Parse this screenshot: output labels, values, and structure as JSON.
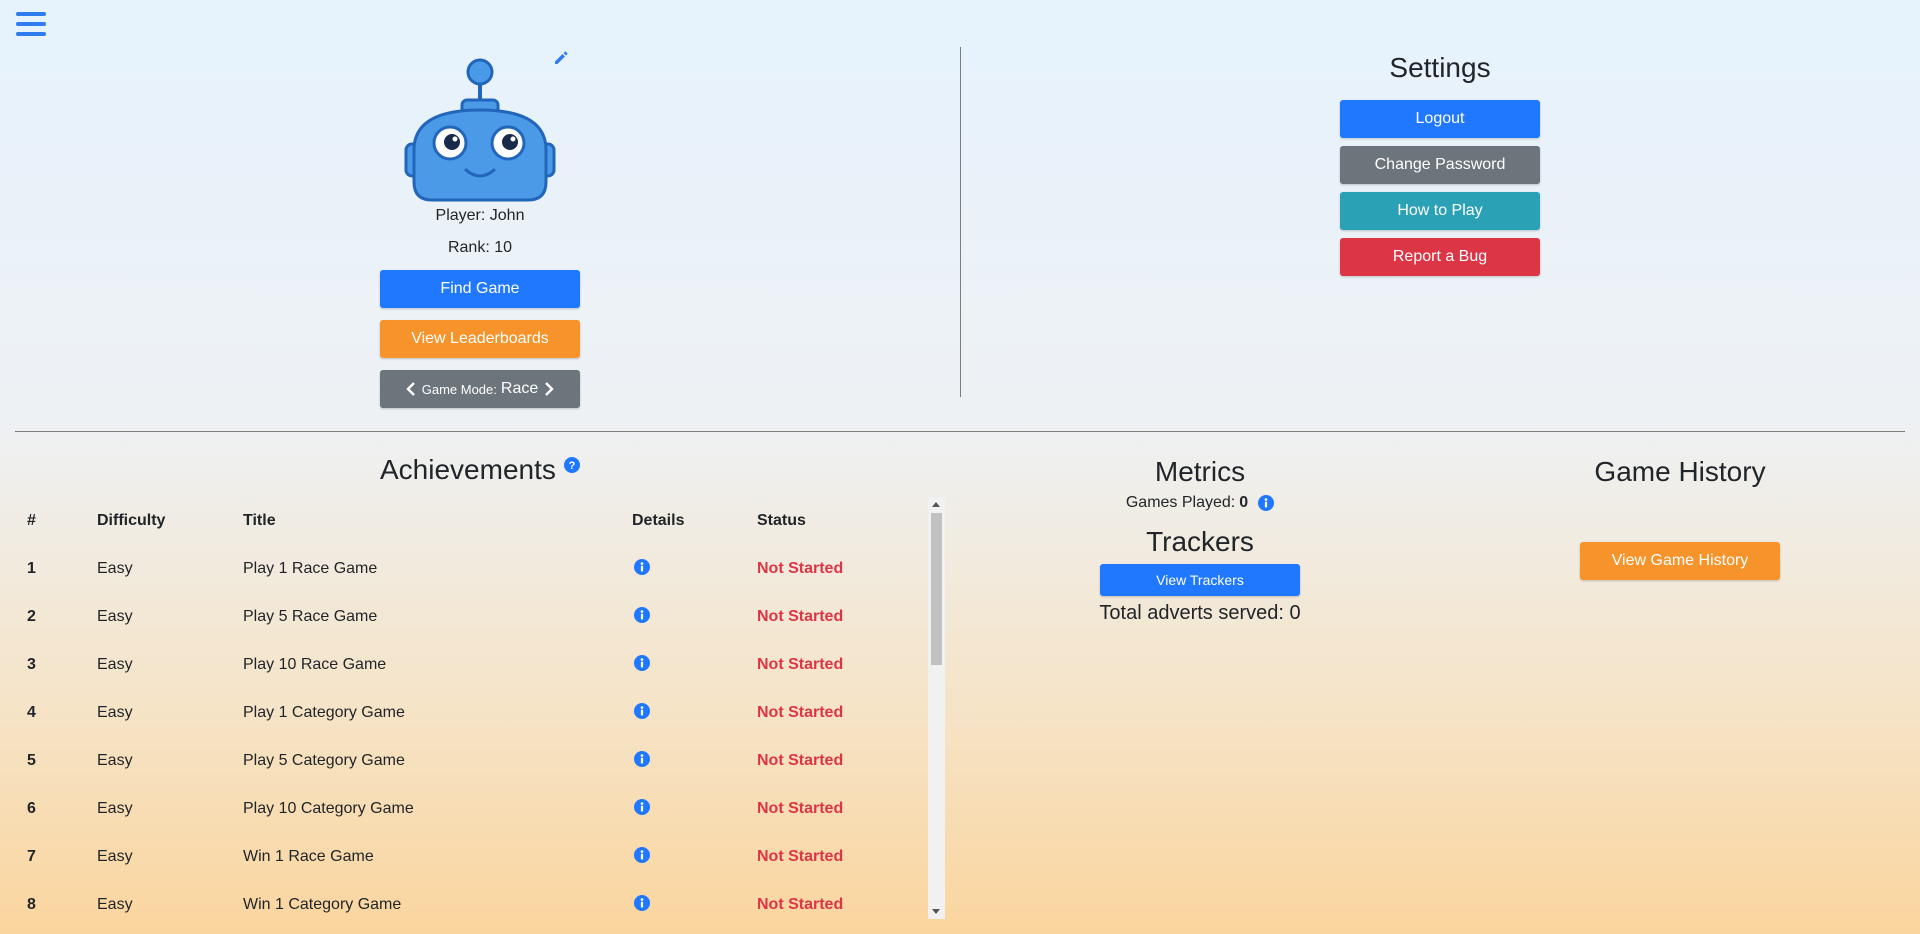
{
  "menu": {
    "icon": "hamburger-menu-icon"
  },
  "profile": {
    "avatar": "robot-avatar",
    "player_label": "Player: John",
    "rank_label": "Rank: 10",
    "find_game": "Find Game",
    "view_leaderboards": "View Leaderboards",
    "game_mode_label": "Game Mode:",
    "game_mode_value": "Race"
  },
  "settings": {
    "title": "Settings",
    "logout": "Logout",
    "change_password": "Change Password",
    "how_to_play": "How to Play",
    "report_bug": "Report a Bug"
  },
  "achievements": {
    "title": "Achievements",
    "columns": [
      "#",
      "Difficulty",
      "Title",
      "Details",
      "Status"
    ],
    "rows": [
      {
        "num": "1",
        "difficulty": "Easy",
        "title": "Play 1 Race Game",
        "status": "Not Started"
      },
      {
        "num": "2",
        "difficulty": "Easy",
        "title": "Play 5 Race Game",
        "status": "Not Started"
      },
      {
        "num": "3",
        "difficulty": "Easy",
        "title": "Play 10 Race Game",
        "status": "Not Started"
      },
      {
        "num": "4",
        "difficulty": "Easy",
        "title": "Play 1 Category Game",
        "status": "Not Started"
      },
      {
        "num": "5",
        "difficulty": "Easy",
        "title": "Play 5 Category Game",
        "status": "Not Started"
      },
      {
        "num": "6",
        "difficulty": "Easy",
        "title": "Play 10 Category Game",
        "status": "Not Started"
      },
      {
        "num": "7",
        "difficulty": "Easy",
        "title": "Win 1 Race Game",
        "status": "Not Started"
      },
      {
        "num": "8",
        "difficulty": "Easy",
        "title": "Win 1 Category Game",
        "status": "Not Started"
      }
    ]
  },
  "metrics": {
    "title": "Metrics",
    "games_played_label": "Games Played:",
    "games_played_value": "0",
    "trackers_title": "Trackers",
    "view_trackers": "View Trackers",
    "adverts": "Total adverts served: 0"
  },
  "history": {
    "title": "Game History",
    "view_history": "View Game History"
  },
  "colors": {
    "primary": "#1f78ff",
    "orange": "#f6942b",
    "gray": "#6c747c",
    "teal": "#2aa1b4",
    "red": "#dc3545"
  }
}
